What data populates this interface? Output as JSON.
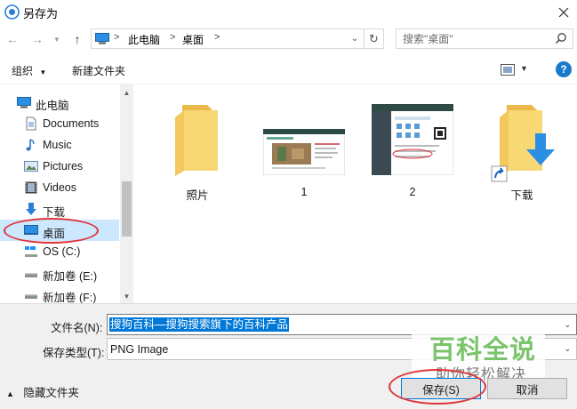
{
  "window": {
    "title": "另存为"
  },
  "address": {
    "crumbs": [
      "此电脑",
      "桌面"
    ],
    "search_placeholder": "搜索\"桌面\""
  },
  "toolbar": {
    "organize": "组织",
    "new_folder": "新建文件夹"
  },
  "nav": {
    "items": [
      {
        "label": "此电脑",
        "icon": "computer-icon"
      },
      {
        "label": "Documents",
        "icon": "documents-icon"
      },
      {
        "label": "Music",
        "icon": "music-icon"
      },
      {
        "label": "Pictures",
        "icon": "pictures-icon"
      },
      {
        "label": "Videos",
        "icon": "videos-icon"
      },
      {
        "label": "下载",
        "icon": "download-icon"
      },
      {
        "label": "桌面",
        "icon": "desktop-icon",
        "selected": true
      },
      {
        "label": "OS (C:)",
        "icon": "windows-drive-icon"
      },
      {
        "label": "新加卷 (E:)",
        "icon": "drive-icon"
      },
      {
        "label": "新加卷 (F:)",
        "icon": "drive-icon"
      }
    ]
  },
  "files": [
    {
      "label": "照片",
      "kind": "folder"
    },
    {
      "label": "1",
      "kind": "image"
    },
    {
      "label": "2",
      "kind": "image"
    },
    {
      "label": "下载",
      "kind": "folder-shortcut"
    }
  ],
  "form": {
    "filename_label": "文件名(N):",
    "filename_value": "搜狗百科—搜狗搜索旗下的百科产品",
    "type_label": "保存类型(T):",
    "type_value": "PNG Image"
  },
  "footer": {
    "hide_folders": "隐藏文件夹",
    "save": "保存(S)",
    "cancel": "取消"
  },
  "watermark": {
    "title": "百科全说",
    "subtitle": "助你轻松解决"
  },
  "colors": {
    "accent": "#0078d7",
    "selection": "#cce8ff",
    "annotation": "#e0343b",
    "folder": "#f8d775",
    "watermark": "#7bc46b"
  }
}
